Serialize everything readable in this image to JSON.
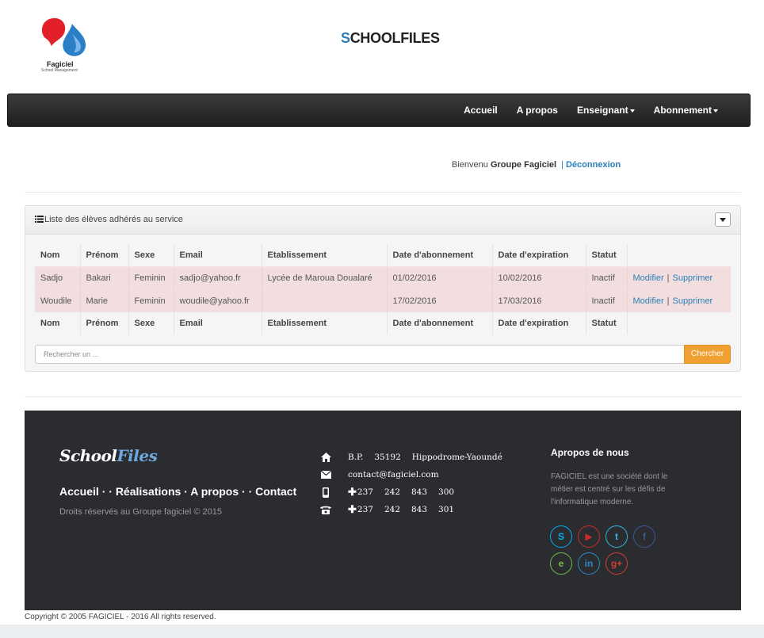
{
  "header": {
    "logo_name": "Fagiciel",
    "logo_sub": "School Management",
    "site_title_first": "S",
    "site_title_rest": "CHOOLFILES"
  },
  "nav": {
    "items": [
      {
        "label": "Accueil"
      },
      {
        "label": "A propos"
      },
      {
        "label": "Enseignant"
      },
      {
        "label": "Abonnement"
      }
    ]
  },
  "welcome": {
    "prefix": "Bienvenu",
    "user": "Groupe Fagiciel",
    "separator": "|",
    "logout": "Déconnexion"
  },
  "panel": {
    "title": "Liste des élèves adhérés au service",
    "columns": [
      "Nom",
      "Prénom",
      "Sexe",
      "Email",
      "Etablissement",
      "Date d'abonnement",
      "Date d'expiration",
      "Statut"
    ],
    "rows": [
      {
        "nom": "Sadjo",
        "prenom": "Bakari",
        "sexe": "Feminin",
        "email": "sadjo@yahoo.fr",
        "etablissement": "Lycée de Maroua Doualaré",
        "date_abonnement": "01/02/2016",
        "date_expiration": "10/02/2016",
        "statut": "Inactif",
        "modify": "Modifier",
        "delete": "Supprimer"
      },
      {
        "nom": "Woudile",
        "prenom": "Marie",
        "sexe": "Feminin",
        "email": "woudile@yahoo.fr",
        "etablissement": "",
        "date_abonnement": "17/02/2016",
        "date_expiration": "17/03/2016",
        "statut": "Inactif",
        "modify": "Modifier",
        "delete": "Supprimer"
      }
    ],
    "action_separator": "|",
    "search_placeholder": "Rechercher un ...",
    "search_button": "Chercher"
  },
  "footer": {
    "brand_a": "School",
    "brand_b": "Files",
    "links": [
      "Accueil",
      "Réalisations",
      "A propos",
      "Contact"
    ],
    "links_sep_1": " · · ",
    "links_sep_2": " · ",
    "links_sep_3": " · · ",
    "rights": "Droits réservés au Groupe fagiciel © 2015",
    "address": {
      "bp": "B.P.",
      "num": "35192",
      "place": "Hippodrome-Yaoundé"
    },
    "email": "contact@fagiciel.com",
    "phone_mobile": [
      "237",
      "242",
      "843",
      "300"
    ],
    "phone_fixed": [
      "237",
      "242",
      "843",
      "301"
    ],
    "about_title": "Apropos de nous",
    "about_text": "FAGICIEL est une société dont le métier est centré sur les défis de l'informatique moderne.",
    "social": [
      {
        "icon": "skype-icon",
        "glyph": "S",
        "color": "#00aff0"
      },
      {
        "icon": "youtube-icon",
        "glyph": "▶",
        "color": "#cc2b2b"
      },
      {
        "icon": "twitter-icon",
        "glyph": "t",
        "color": "#33b5e5"
      },
      {
        "icon": "facebook-icon",
        "glyph": "f",
        "color": "#3b5998"
      },
      {
        "icon": "evernote-icon",
        "glyph": "e",
        "color": "#6fbe44"
      },
      {
        "icon": "linkedin-icon",
        "glyph": "in",
        "color": "#2e8bc9"
      },
      {
        "icon": "googleplus-icon",
        "glyph": "g+",
        "color": "#d23e30"
      }
    ]
  },
  "copyright": "Copyright © 2005 FAGICIEL - 2016 All rights reserved."
}
